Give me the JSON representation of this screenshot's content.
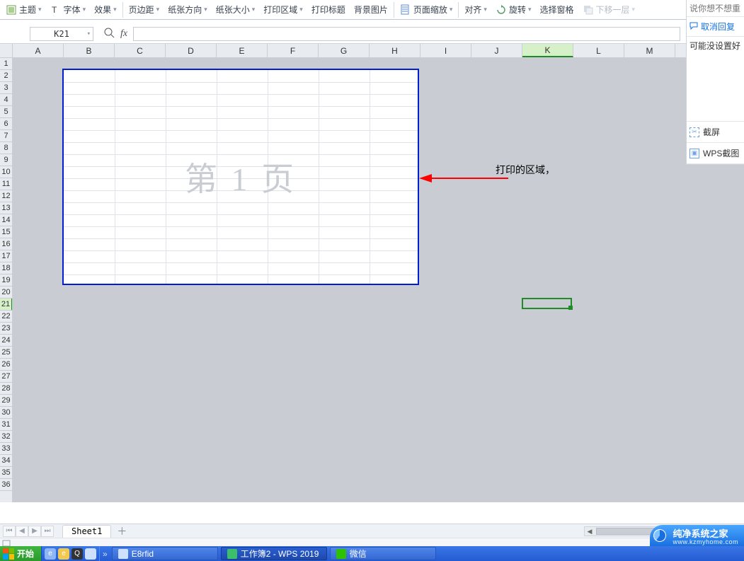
{
  "toolbar": {
    "theme": "主题",
    "font": "字体",
    "effect": "效果",
    "margins": "页边距",
    "orientation": "纸张方向",
    "size": "纸张大小",
    "print_area": "打印区域",
    "print_titles": "打印标题",
    "background": "背景图片",
    "scale": "页面缩放",
    "align": "对齐",
    "rotate": "旋转",
    "pane": "选择窗格",
    "send_back": "下移一层"
  },
  "namebox": {
    "value": "K21"
  },
  "fx": {
    "label": "fx"
  },
  "columns": [
    "A",
    "B",
    "C",
    "D",
    "E",
    "F",
    "G",
    "H",
    "I",
    "J",
    "K",
    "L",
    "M"
  ],
  "active_col": "K",
  "row_start": 1,
  "row_end": 36,
  "active_row": 21,
  "print": {
    "left_col": 1,
    "right_col": 7,
    "top_row": 2,
    "bottom_row": 19,
    "watermark": "第 1 页"
  },
  "annotation": {
    "label": "打印的区域，"
  },
  "sheet_tabs": {
    "active": "Sheet1"
  },
  "side_panel": {
    "hint_top": "说你想不想重",
    "cancel_link": "取消回复",
    "body_text": "可能没设置好",
    "shot": "截屏",
    "wps_shot": "WPS截图"
  },
  "taskbar": {
    "start": "开始",
    "app1": "E8rfid",
    "app2": "工作簿2 - WPS 2019",
    "app3": "微信"
  },
  "watermark": {
    "title": "纯净系统之家",
    "sub": "www.kzmyhome.com"
  }
}
